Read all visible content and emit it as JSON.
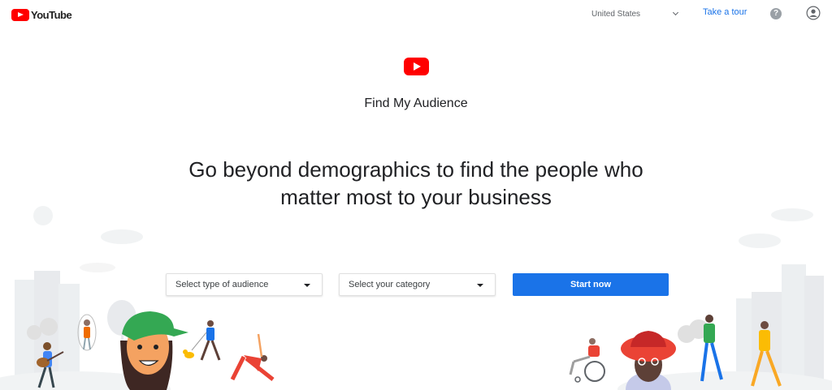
{
  "header": {
    "logo_text": "YouTube",
    "country": "United States",
    "tour_label": "Take a tour",
    "help_symbol": "?"
  },
  "hero": {
    "product_name": "Find My Audience",
    "headline": "Go beyond demographics to find the people who matter most to your business"
  },
  "form": {
    "audience_select": "Select type of audience",
    "category_select": "Select your category",
    "start_label": "Start now"
  },
  "colors": {
    "brand_red": "#ff0000",
    "accent_blue": "#1a73e8",
    "text": "#202124",
    "illustration_gray": "#e8eaed"
  },
  "icons": [
    "youtube-logo-icon",
    "chevron-down-icon",
    "help-icon",
    "account-icon",
    "caret-down-icon"
  ]
}
